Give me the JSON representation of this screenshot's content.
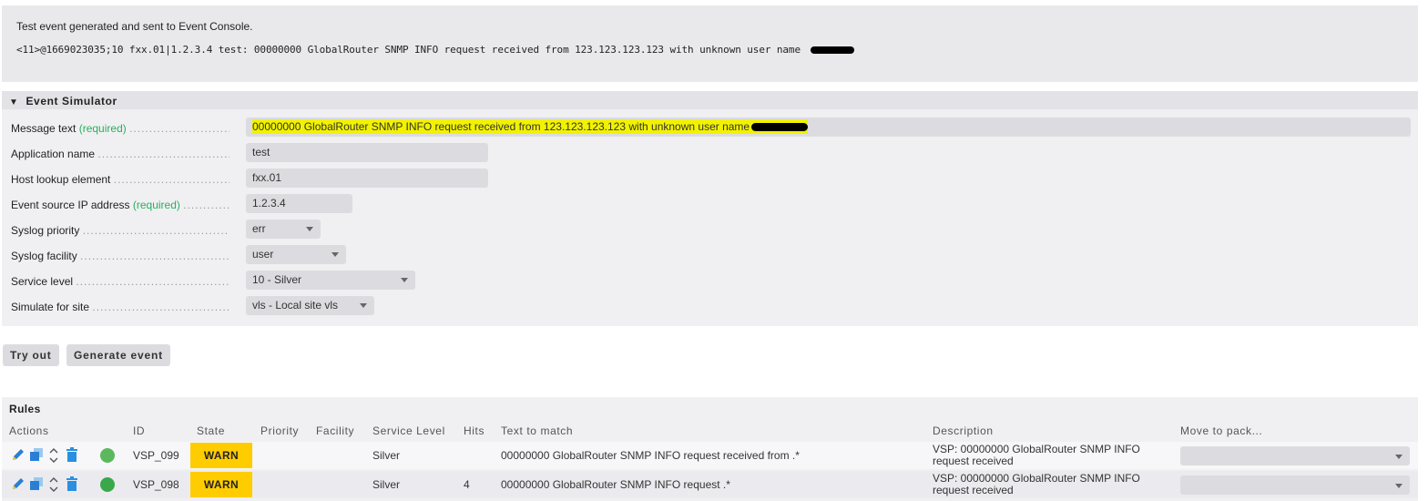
{
  "message": {
    "title": "Test event generated and sent to Event Console.",
    "raw": "<11>@1669023035;10 fxx.01|1.2.3.4 test: 00000000 GlobalRouter SNMP INFO request received from 123.123.123.123 with unknown user name"
  },
  "simulator": {
    "title": "Event Simulator",
    "required_tag": "(required)",
    "fields": {
      "message_text": {
        "label": "Message text",
        "value": "00000000 GlobalRouter SNMP INFO request received from 123.123.123.123 with unknown user name"
      },
      "application_name": {
        "label": "Application name",
        "value": "test"
      },
      "host_lookup": {
        "label": "Host lookup element",
        "value": "fxx.01"
      },
      "source_ip": {
        "label": "Event source IP address",
        "value": "1.2.3.4"
      },
      "syslog_priority": {
        "label": "Syslog priority",
        "value": "err"
      },
      "syslog_facility": {
        "label": "Syslog facility",
        "value": "user"
      },
      "service_level": {
        "label": "Service level",
        "value": "10 - Silver"
      },
      "site": {
        "label": "Simulate for site",
        "value": "vls - Local site vls"
      }
    },
    "highlight_color": "#f2f200"
  },
  "buttons": {
    "try_out": "Try out",
    "generate": "Generate event"
  },
  "rules": {
    "title": "Rules",
    "columns": [
      "Actions",
      "ID",
      "State",
      "Priority",
      "Facility",
      "Service Level",
      "Hits",
      "Text to match",
      "Description",
      "Move to pack..."
    ],
    "rows": [
      {
        "id": "VSP_099",
        "state": "WARN",
        "priority": "",
        "facility": "",
        "service_level": "Silver",
        "hits": "",
        "text_to_match": "00000000 GlobalRouter SNMP INFO request received from .*",
        "description": "VSP: 00000000 GlobalRouter SNMP INFO request received",
        "status_color": "#5cb85c"
      },
      {
        "id": "VSP_098",
        "state": "WARN",
        "priority": "",
        "facility": "",
        "service_level": "Silver",
        "hits": "4",
        "text_to_match": "00000000 GlobalRouter SNMP INFO request .*",
        "description": "VSP: 00000000 GlobalRouter SNMP INFO request received",
        "status_color": "#3aa84a"
      }
    ],
    "warn_color": "#ffcc00"
  }
}
